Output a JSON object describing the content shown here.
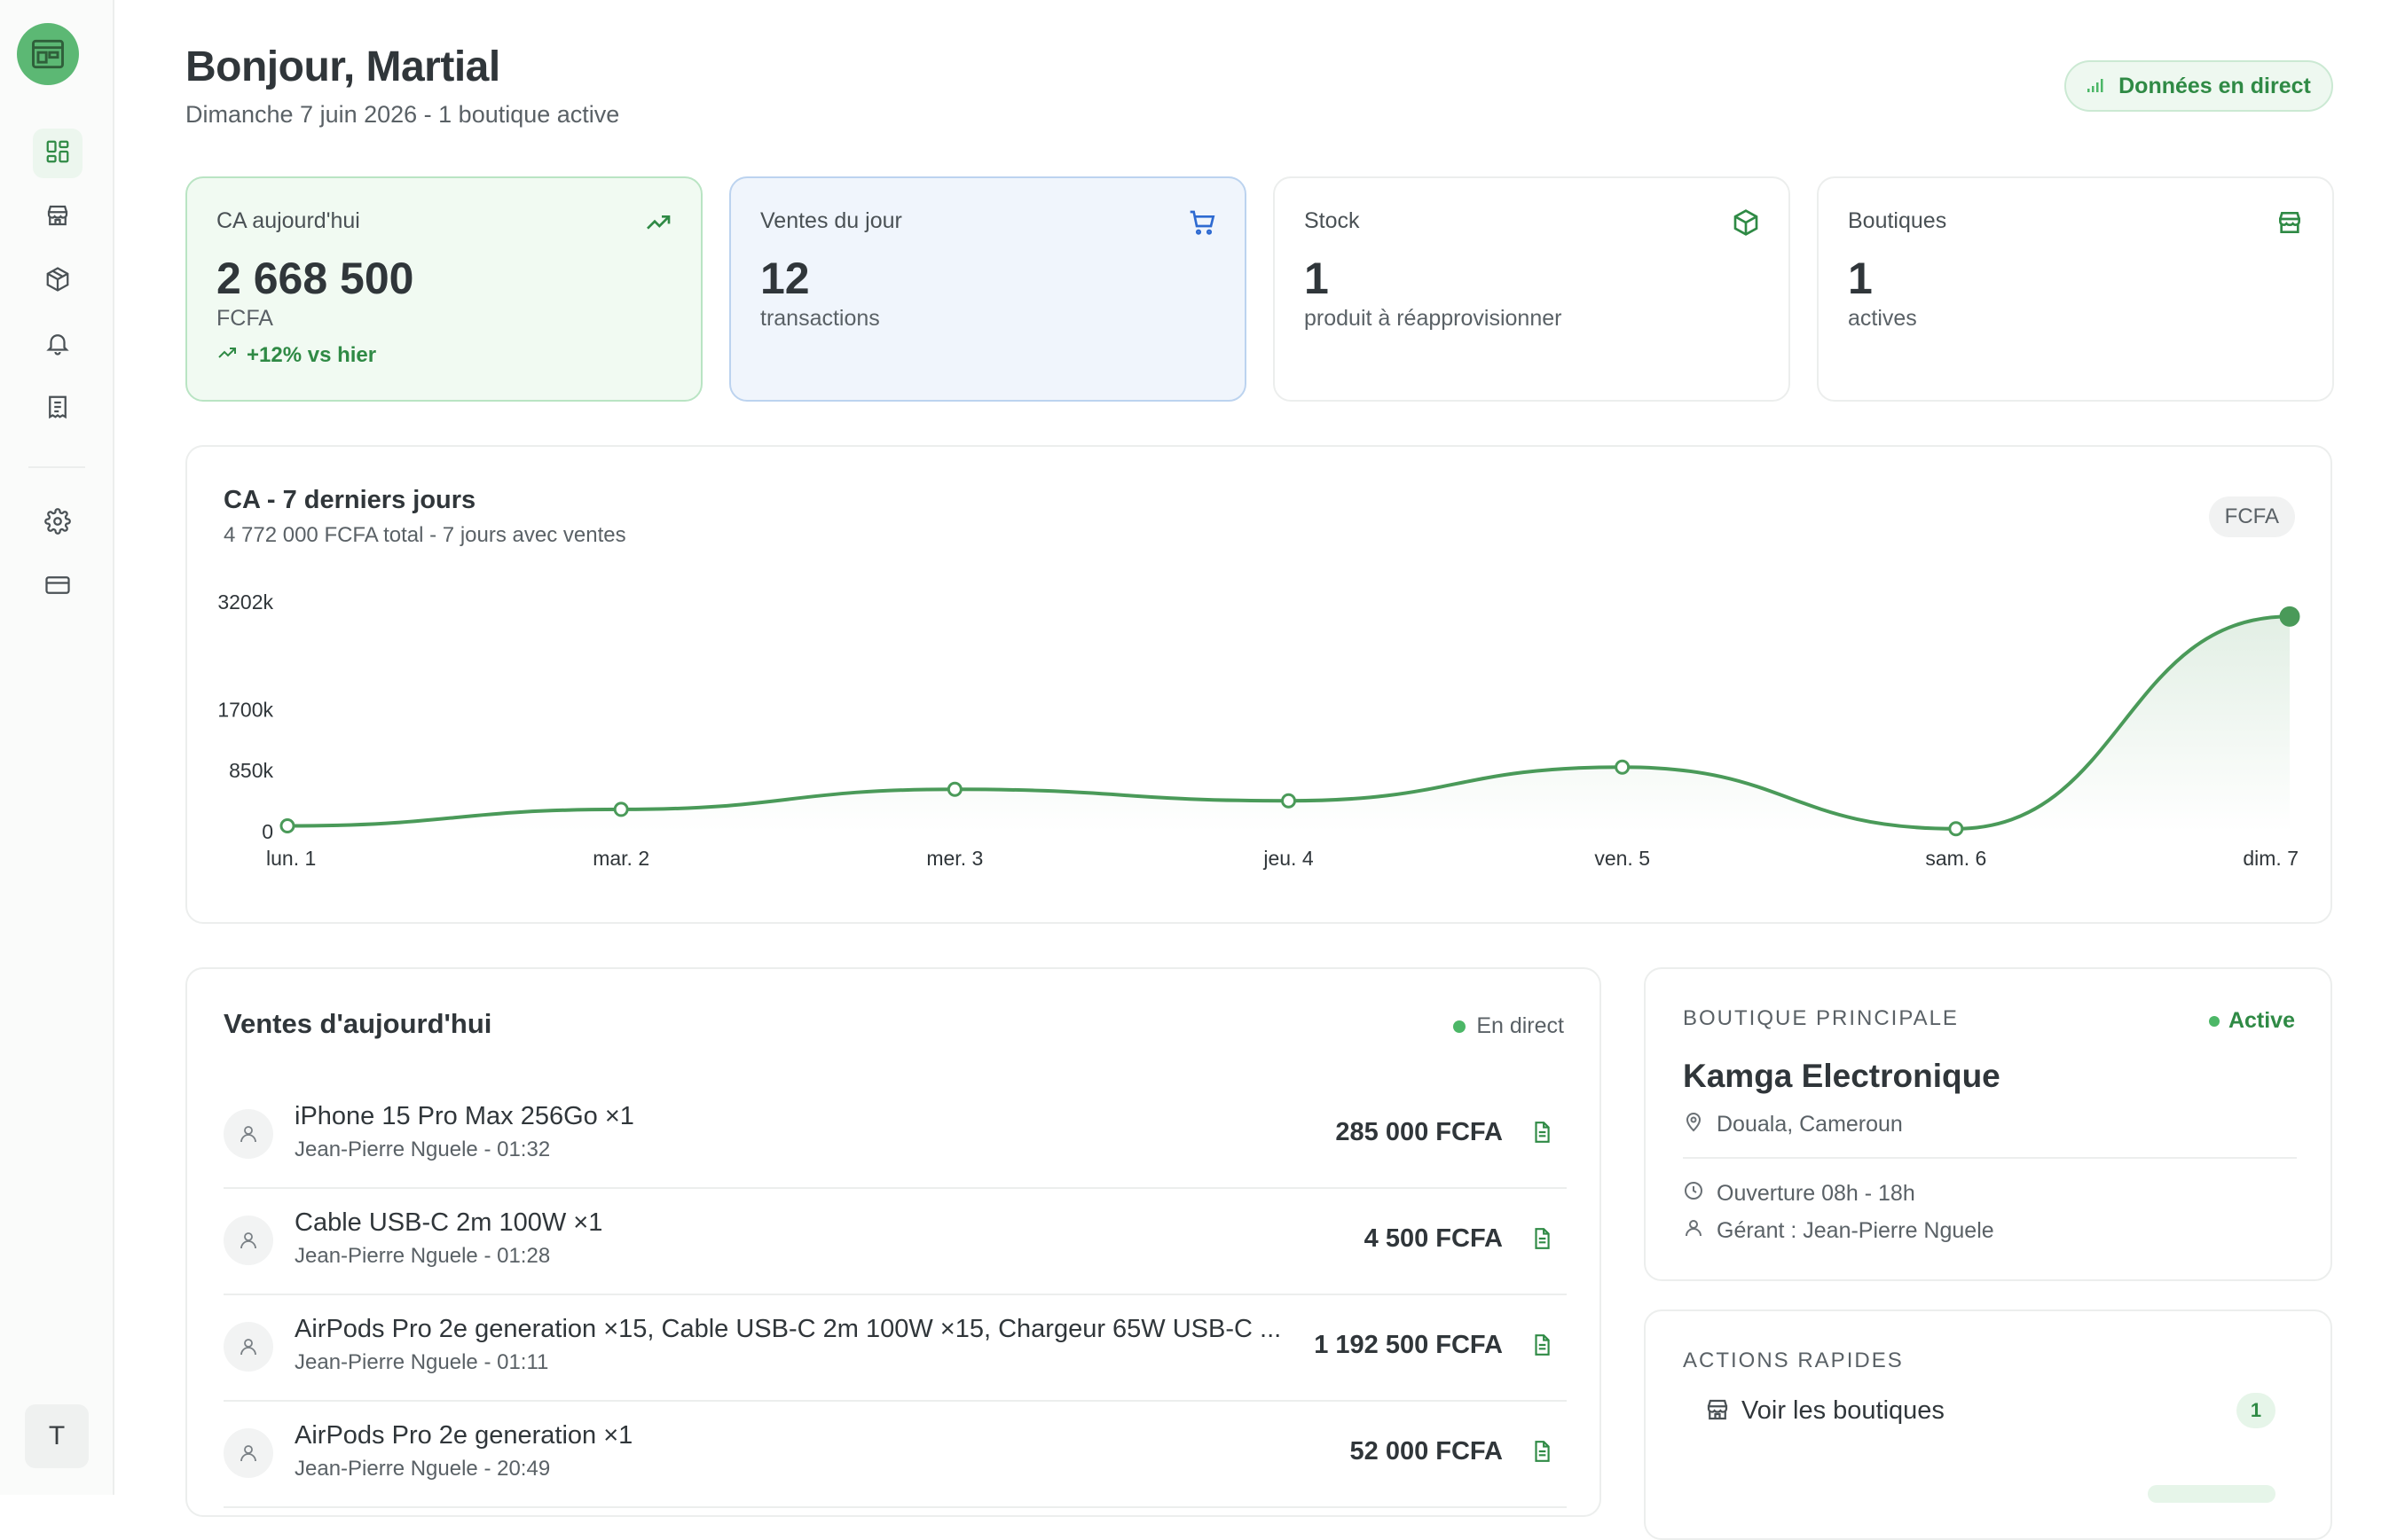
{
  "sidebar": {
    "avatar_initial": "T",
    "icons": [
      "dashboard-icon",
      "store-icon",
      "box-icon",
      "bell-icon",
      "receipt-icon",
      "gear-icon",
      "credit-card-icon"
    ]
  },
  "header": {
    "greeting": "Bonjour, Martial",
    "subtitle": "Dimanche 7 juin 2026 - 1 boutique active",
    "live_label": "Données en direct"
  },
  "stats": [
    {
      "title": "CA aujourd'hui",
      "value": "2 668 500",
      "unit": "FCFA",
      "trend": "+12% vs hier",
      "icon": "trending-up-icon"
    },
    {
      "title": "Ventes du jour",
      "value": "12",
      "unit": "transactions",
      "icon": "cart-icon"
    },
    {
      "title": "Stock",
      "value": "1",
      "unit": "produit à réapprovisionner",
      "icon": "box-icon"
    },
    {
      "title": "Boutiques",
      "value": "1",
      "unit": "actives",
      "icon": "store-icon"
    }
  ],
  "chart": {
    "title": "CA - 7 derniers jours",
    "subtitle": "4 772 000 FCFA total - 7 jours avec ventes",
    "currency_pill": "FCFA"
  },
  "chart_data": {
    "type": "area",
    "categories": [
      "lun. 1",
      "mar. 2",
      "mer. 3",
      "jeu. 4",
      "ven. 5",
      "sam. 6",
      "dim. 7"
    ],
    "values": [
      80000,
      310000,
      590000,
      430000,
      900000,
      40000,
      3000000
    ],
    "yticks": [
      {
        "value": 0,
        "label": "0"
      },
      {
        "value": 850000,
        "label": "850k"
      },
      {
        "value": 1700000,
        "label": "1700k"
      },
      {
        "value": 3202000,
        "label": "3202k"
      }
    ],
    "ylim": [
      0,
      3202000
    ],
    "grid": false,
    "color": "#4a9a59"
  },
  "sales": {
    "title": "Ventes d'aujourd'hui",
    "live": "En direct",
    "rows": [
      {
        "item": "iPhone 15 Pro Max 256Go ×1",
        "meta": "Jean-Pierre Nguele - 01:32",
        "amount": "285 000 FCFA"
      },
      {
        "item": "Cable USB-C 2m 100W ×1",
        "meta": "Jean-Pierre Nguele - 01:28",
        "amount": "4 500 FCFA"
      },
      {
        "item": "AirPods Pro 2e generation ×15, Cable USB-C 2m 100W ×15, Chargeur 65W USB-C ...",
        "meta": "Jean-Pierre Nguele - 01:11",
        "amount": "1 192 500 FCFA"
      },
      {
        "item": "AirPods Pro 2e generation ×1",
        "meta": "Jean-Pierre Nguele - 20:49",
        "amount": "52 000 FCFA"
      }
    ]
  },
  "shop": {
    "eyebrow": "BOUTIQUE PRINCIPALE",
    "status": "Active",
    "name": "Kamga Electronique",
    "location": "Douala, Cameroun",
    "hours": "Ouverture 08h - 18h",
    "manager": "Gérant : Jean-Pierre Nguele"
  },
  "actions": {
    "eyebrow": "ACTIONS RAPIDES",
    "items": [
      {
        "label": "Voir les boutiques",
        "badge": "1"
      }
    ]
  },
  "colors": {
    "accent": "#4a9a59",
    "green_bg": "#f1faf2",
    "blue_bg": "#f0f5fc",
    "cart_blue": "#2e6ad1"
  }
}
